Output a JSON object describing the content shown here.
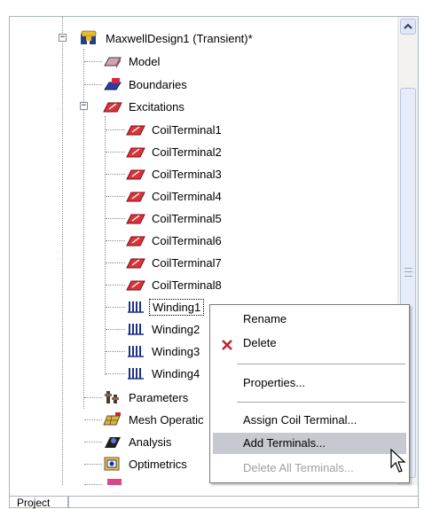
{
  "tree": {
    "root": {
      "label": "MaxwellDesign1 (Transient)*",
      "expanded": true,
      "icon": "maxwell-design-icon"
    },
    "nodes": [
      {
        "key": "model",
        "label": "Model",
        "icon": "model-icon"
      },
      {
        "key": "boundaries",
        "label": "Boundaries",
        "icon": "boundaries-icon"
      },
      {
        "key": "excitations",
        "label": "Excitations",
        "icon": "excitations-icon",
        "expanded": true
      }
    ],
    "coil_terminals": [
      "CoilTerminal1",
      "CoilTerminal2",
      "CoilTerminal3",
      "CoilTerminal4",
      "CoilTerminal5",
      "CoilTerminal6",
      "CoilTerminal7",
      "CoilTerminal8"
    ],
    "windings": [
      "Winding1",
      "Winding2",
      "Winding3",
      "Winding4"
    ],
    "selected": "Winding1",
    "lower_nodes": [
      {
        "key": "parameters",
        "label": "Parameters",
        "icon": "parameters-icon"
      },
      {
        "key": "mesh",
        "label": "Mesh Operatic",
        "icon": "mesh-operations-icon"
      },
      {
        "key": "analysis",
        "label": "Analysis",
        "icon": "analysis-icon"
      },
      {
        "key": "optimetrics",
        "label": "Optimetrics",
        "icon": "optimetrics-icon"
      }
    ]
  },
  "context_menu": {
    "items": [
      {
        "label": "Rename",
        "icon": ""
      },
      {
        "label": "Delete",
        "icon": "delete-x-icon"
      },
      {
        "label": "Properties...",
        "icon": ""
      },
      {
        "label": "Assign Coil Terminal...",
        "icon": ""
      },
      {
        "label": "Add Terminals...",
        "icon": "",
        "highlighted": true
      },
      {
        "label": "Delete All Terminals...",
        "icon": "",
        "disabled": true
      }
    ]
  },
  "bottom_tab": {
    "label": "Project"
  },
  "colors": {
    "menu_highlight": "#c6c9cf",
    "excitation_red": "#d9343a",
    "tree_line": "#8a8a8a"
  }
}
